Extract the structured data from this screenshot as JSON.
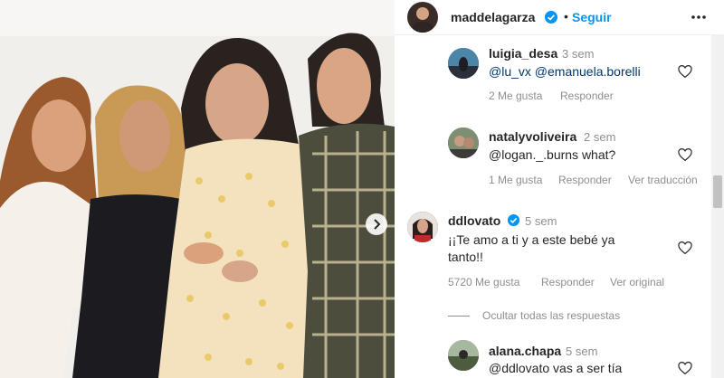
{
  "header": {
    "username": "maddelagarza",
    "separator": "•",
    "follow_label": "Seguir",
    "more_icon": "more-horizontal-icon",
    "verified_icon": "verified-badge-icon"
  },
  "comments": [
    {
      "username": "luigia_desa",
      "time": "3 sem",
      "text": "@lu_vx @emanuela.borelli",
      "likes": "2 Me gusta",
      "reply": "Responder"
    },
    {
      "username": "natalyvoliveira",
      "time": "2 sem",
      "text": "@logan._.burns what?",
      "likes": "1 Me gusta",
      "reply": "Responder",
      "translate": "Ver traducción"
    },
    {
      "username": "ddlovato",
      "time": "5 sem",
      "text_line1": "¡¡Te amo a ti y a este bebé ya",
      "text_line2": "tanto!!",
      "likes": "5720 Me gusta",
      "reply": "Responder",
      "original": "Ver original"
    },
    {
      "username": "alana.chapa",
      "time": "5 sem",
      "text": "@ddlovato vas a ser tía"
    }
  ],
  "hide_replies_label": "Ocultar todas las respuestas",
  "colors": {
    "accent": "#0095f6",
    "verified": "#0095f6",
    "text": "#262626",
    "muted": "#8e8e8e"
  }
}
